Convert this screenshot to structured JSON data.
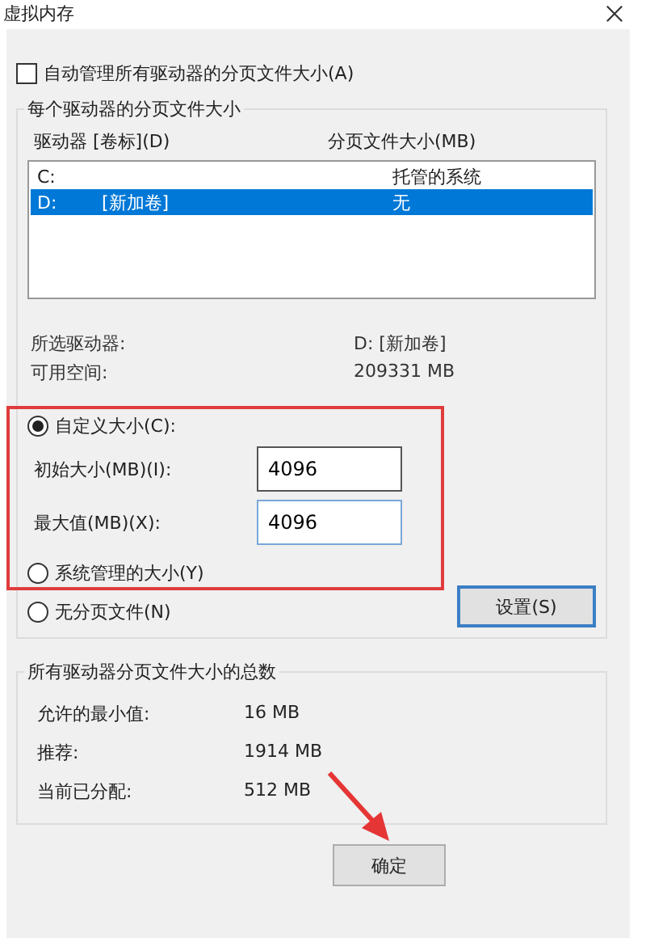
{
  "window": {
    "title": "虚拟内存"
  },
  "auto_manage": {
    "label": "自动管理所有驱动器的分页文件大小(A)",
    "checked": false
  },
  "per_drive": {
    "title": "每个驱动器的分页文件大小",
    "columns": [
      "驱动器 [卷标](D)",
      "分页文件大小(MB)"
    ],
    "rows": [
      {
        "drive": "C:",
        "label": "",
        "size": "托管的系统",
        "selected": false
      },
      {
        "drive": "D:",
        "label": "[新加卷]",
        "size": "无",
        "selected": true
      }
    ],
    "info": [
      {
        "label": "所选驱动器:",
        "value": "D:  [新加卷]"
      },
      {
        "label": "可用空间:",
        "value": "209331 MB"
      }
    ],
    "options": [
      {
        "label": "自定义大小(C):",
        "selected": true
      },
      {
        "label": "系统管理的大小(Y)",
        "selected": false
      },
      {
        "label": "无分页文件(N)",
        "selected": false
      }
    ],
    "fields": [
      {
        "label": "初始大小(MB)(I):",
        "value": "4096",
        "focused": false
      },
      {
        "label": "最大值(MB)(X):",
        "value": "4096",
        "focused": true
      }
    ],
    "set_button": "设置(S)"
  },
  "totals": {
    "title": "所有驱动器分页文件大小的总数",
    "rows": [
      {
        "label": "允许的最小值:",
        "value": "16 MB"
      },
      {
        "label": "推荐:",
        "value": "1914 MB"
      },
      {
        "label": "当前已分配:",
        "value": "512 MB"
      }
    ]
  },
  "ok_button": "确定"
}
